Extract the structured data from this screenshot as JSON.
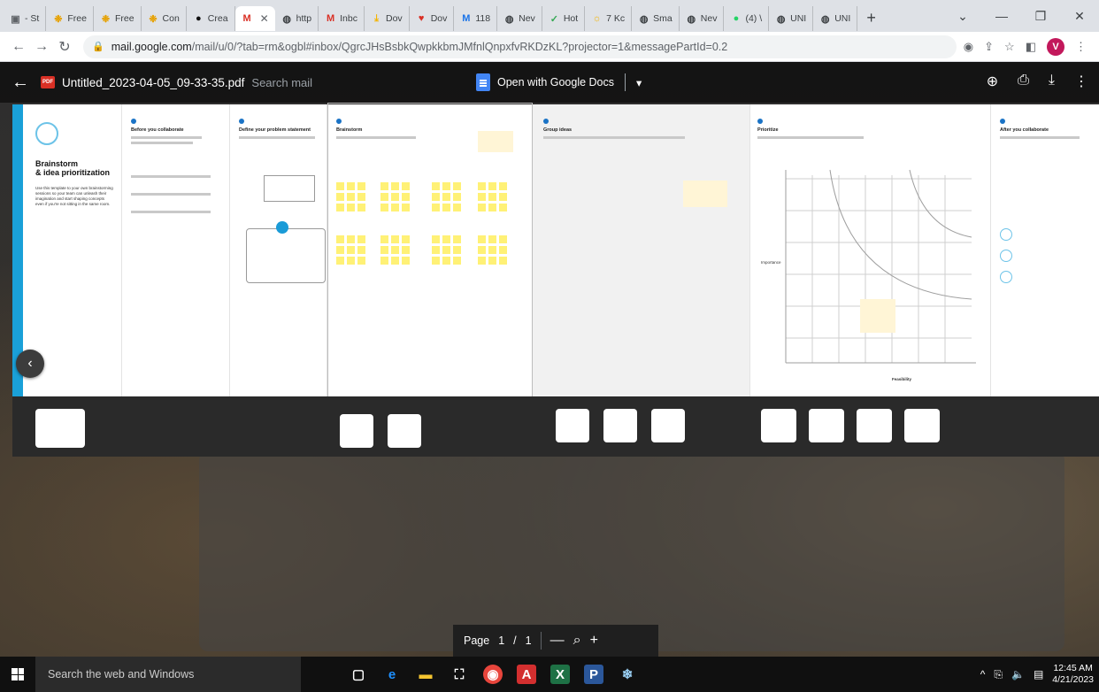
{
  "browser": {
    "tabs": [
      {
        "label": "- St",
        "icon": "square-icon",
        "color": "#5f6368"
      },
      {
        "label": "Free",
        "icon": "sparkle-icon",
        "color": "#e6a100"
      },
      {
        "label": "Free",
        "icon": "sparkle-icon",
        "color": "#e6a100"
      },
      {
        "label": "Con",
        "icon": "sparkle-icon",
        "color": "#e6a100"
      },
      {
        "label": "Crea",
        "icon": "github-icon",
        "color": "#111111"
      },
      {
        "label": "",
        "icon": "gmail-icon",
        "color": "#d93025",
        "active": true
      },
      {
        "label": "http",
        "icon": "globe-icon",
        "color": "#3c4043"
      },
      {
        "label": "Inbc",
        "icon": "gmail-icon",
        "color": "#d93025"
      },
      {
        "label": "Dov",
        "icon": "download-icon",
        "color": "#f4b400"
      },
      {
        "label": "Dov",
        "icon": "heart-icon",
        "color": "#d93025"
      },
      {
        "label": "118",
        "icon": "m-icon",
        "color": "#1a73e8"
      },
      {
        "label": "Nev",
        "icon": "globe-icon",
        "color": "#3c4043"
      },
      {
        "label": "Hot",
        "icon": "leaf-icon",
        "color": "#34a853"
      },
      {
        "label": "7 Kc",
        "icon": "sun-icon",
        "color": "#f4b400"
      },
      {
        "label": "Sma",
        "icon": "globe-icon",
        "color": "#3c4043"
      },
      {
        "label": "Nev",
        "icon": "globe-icon",
        "color": "#3c4043"
      },
      {
        "label": "(4) \\",
        "icon": "whatsapp-icon",
        "color": "#25d366"
      },
      {
        "label": "UNI",
        "icon": "globe-icon",
        "color": "#3c4043"
      },
      {
        "label": "UNI",
        "icon": "globe-icon",
        "color": "#3c4043"
      }
    ],
    "new_tab": "+",
    "url_host": "mail.google.com",
    "url_path": "/mail/u/0/?tab=rm&ogbl#inbox/QgrcJHsBsbkQwpkkbmJMfnlQnpxfvRKDzKL?projector=1&messagePartId=0.2",
    "profile_initial": "V"
  },
  "viewer": {
    "file_badge": "PDF",
    "filename": "Untitled_2023-04-05_09-33-35.pdf",
    "ghost_search": "Search mail",
    "open_with": "Open with Google Docs"
  },
  "document": {
    "title_line1": "Brainstorm",
    "title_line2": "& idea prioritization",
    "intro": "Use this template to your own brainstorming sessions so your team can unleash their imagination and start shaping concepts even if you're not sitting in the same room.",
    "panels": [
      {
        "heading": "Before you collaborate"
      },
      {
        "heading": "Define your problem statement"
      },
      {
        "heading": "Brainstorm"
      },
      {
        "heading": "Group ideas"
      },
      {
        "heading": "Prioritize"
      },
      {
        "heading": "After you collaborate"
      }
    ],
    "axis_label": "Feasibility",
    "importance_label": "Importance"
  },
  "page_controls": {
    "label": "Page",
    "current": "1",
    "separator": "/",
    "total": "1"
  },
  "taskbar": {
    "search_placeholder": "Search the web and Windows",
    "time": "12:45 AM",
    "date": "4/21/2023"
  }
}
